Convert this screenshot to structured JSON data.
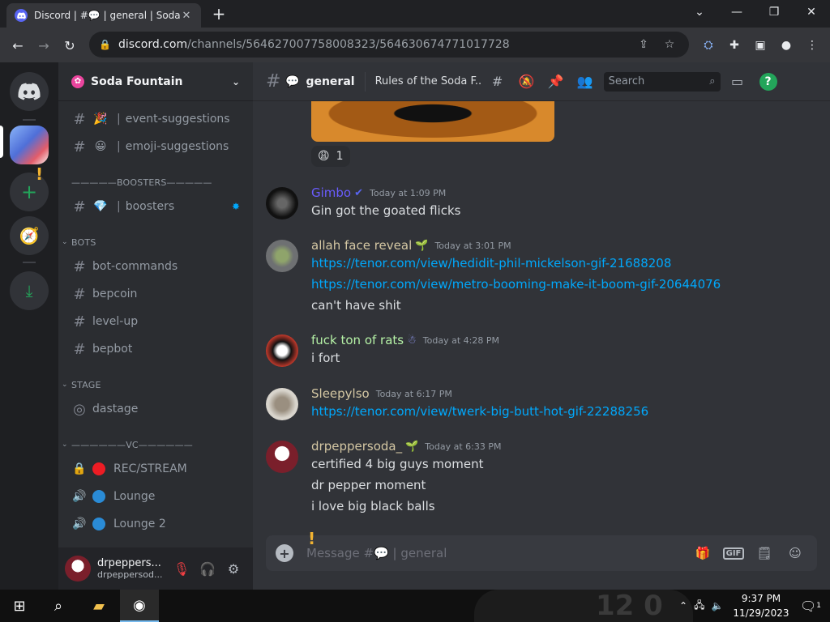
{
  "browser": {
    "tab_title": "Discord | #💬 | general | Soda Fountain",
    "url_host": "discord.com",
    "url_path": "/channels/564627007758008323/564630674771017728",
    "new_tab": "+",
    "minimize": "—",
    "restore": "❐",
    "close": "✕",
    "dropdown": "⌄"
  },
  "server": {
    "name": "Soda Fountain"
  },
  "channels": [
    {
      "emoji": "🎉",
      "name": "event-suggestions"
    },
    {
      "emoji": "😀",
      "name": "emoji-suggestions"
    }
  ],
  "categories": {
    "boosters": "—————BOOSTERS—————",
    "bots": "BOTS",
    "stage": "STAGE",
    "vc": "——————VC——————"
  },
  "booster_channel": {
    "emoji": "💎",
    "name": "boosters"
  },
  "bot_channels": [
    "bot-commands",
    "bepcoin",
    "level-up",
    "bepbot"
  ],
  "stage_channel": "dastage",
  "voice_channels": [
    {
      "name": "REC/STREAM",
      "color": "#ed1c24"
    },
    {
      "name": "Lounge",
      "color": "#2a8bd6"
    },
    {
      "name": "Lounge 2",
      "color": "#2a8bd6"
    }
  ],
  "user": {
    "display": "drpeppers...",
    "tag": "drpeppersod..."
  },
  "header": {
    "channel_name": "general",
    "topic": "Rules of the Soda F...",
    "search_placeholder": "Search"
  },
  "reaction": {
    "emoji": "😩",
    "count": "1"
  },
  "messages": [
    {
      "author": "Gimbo",
      "color": "#6a5cff",
      "badge": "✔",
      "time": "Today at 1:09 PM",
      "lines": [
        "Gin got the goated flicks"
      ],
      "links": []
    },
    {
      "author": "allah face reveal",
      "color": "#d4c7a3",
      "badge": "🌱",
      "time": "Today at 3:01 PM",
      "lines": [],
      "links": [
        "https://tenor.com/view/hedidit-phil-mickelson-gif-21688208",
        "https://tenor.com/view/metro-booming-make-it-boom-gif-20644076"
      ],
      "after": "can't have shit"
    },
    {
      "author": "fuck ton of rats",
      "color": "#b5f2a6",
      "badge": "☃",
      "time": "Today at 4:28 PM",
      "lines": [
        "i fort"
      ],
      "links": []
    },
    {
      "author": "Sleepylso",
      "color": "#d4c7a3",
      "badge": "",
      "time": "Today at 6:17 PM",
      "lines": [],
      "links": [
        "https://tenor.com/view/twerk-big-butt-hot-gif-22288256"
      ]
    },
    {
      "author": "drpeppersoda_",
      "color": "#d4c7a3",
      "badge": "🌱",
      "time": "Today at 6:33 PM",
      "lines": [
        "certified 4 big guys moment",
        "dr pepper moment",
        "i love big black balls"
      ],
      "links": []
    }
  ],
  "composer": {
    "placeholder": "Message #💬 | general"
  },
  "taskbar": {
    "time": "9:37 PM",
    "date": "11/29/2023",
    "wallpaper_text": "12 0",
    "notification_count": "1"
  }
}
